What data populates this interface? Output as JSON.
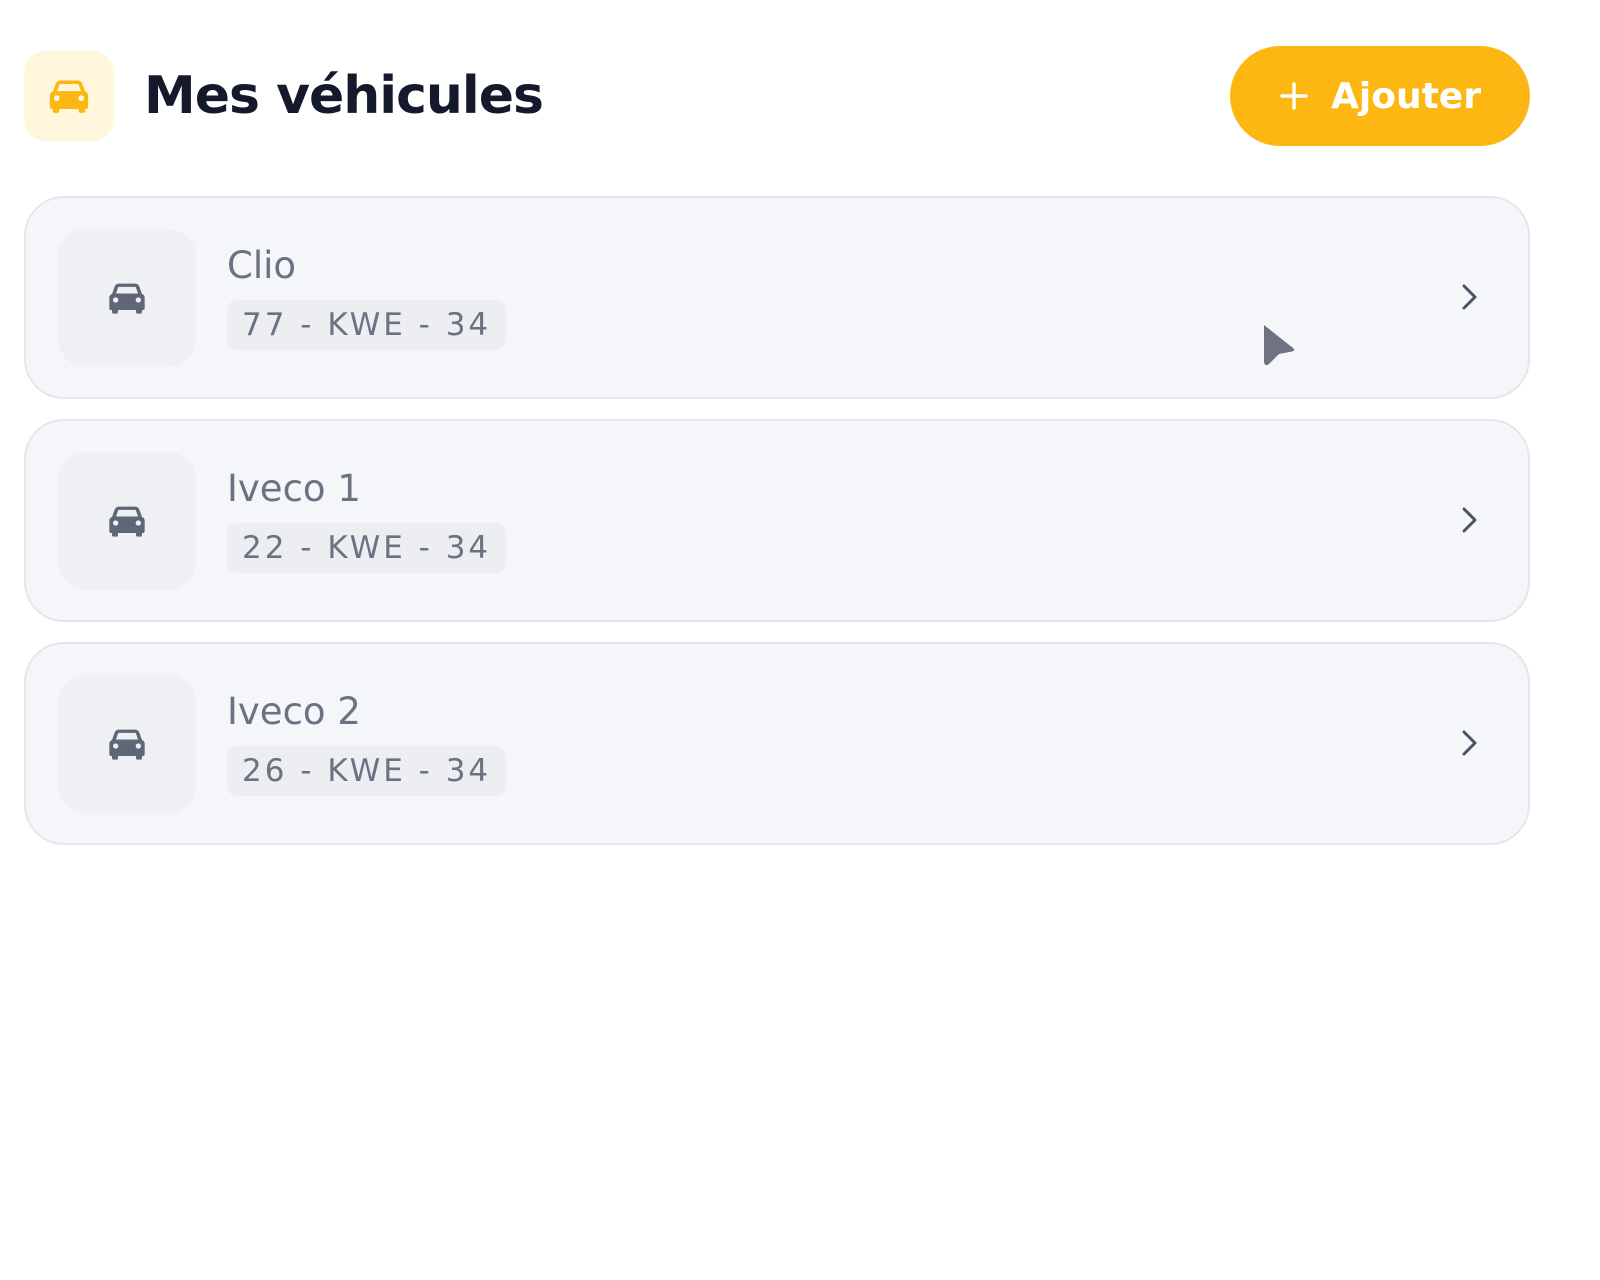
{
  "header": {
    "title": "Mes véhicules",
    "icon": "car-icon",
    "add_button": {
      "label": "Ajouter",
      "icon": "plus-icon"
    }
  },
  "vehicles": [
    {
      "name": "Clio",
      "plate": "77 - KWE - 34",
      "icon": "car-icon"
    },
    {
      "name": "Iveco 1",
      "plate": "22 - KWE - 34",
      "icon": "car-icon"
    },
    {
      "name": "Iveco 2",
      "plate": "26 - KWE - 34",
      "icon": "car-icon"
    }
  ],
  "colors": {
    "accent": "#FDB712",
    "accent_soft": "#FFF6DC",
    "title": "#141A2B",
    "muted_text": "#6B7281",
    "card_background": "#F5F6FA",
    "card_border": "#E4E6EC"
  }
}
